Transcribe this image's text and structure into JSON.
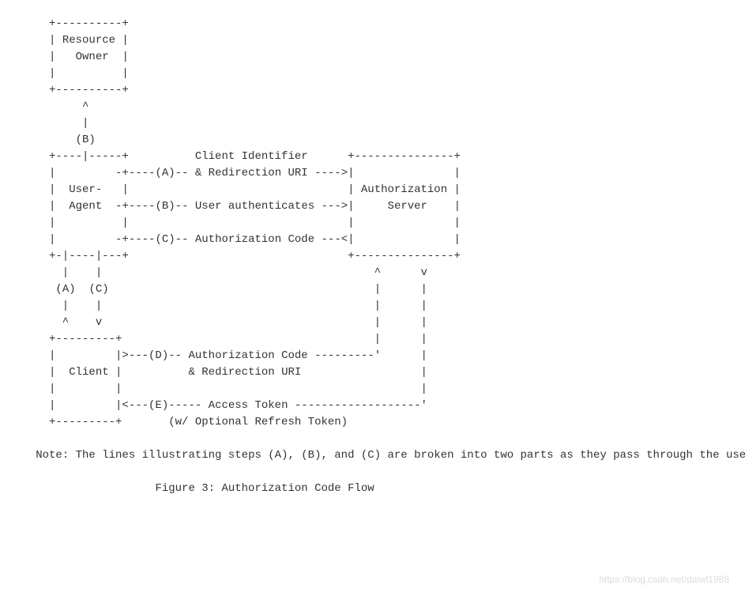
{
  "diagram": {
    "boxes": {
      "resource_owner_line1": "Resource",
      "resource_owner_line2": "Owner",
      "user_agent_line1": "User-",
      "user_agent_line2": "Agent",
      "authorization_server_line1": "Authorization",
      "authorization_server_line2": "Server",
      "client": "Client"
    },
    "steps": {
      "A_label": "(A)",
      "B_label": "(B)",
      "C_label": "(C)",
      "D_label": "(D)",
      "E_label": "(E)"
    },
    "flows": {
      "A_text_line1": "Client Identifier",
      "A_text_line2": "& Redirection URI",
      "B_text": "User authenticates",
      "C_text": "Authorization Code",
      "D_text_line1": "Authorization Code",
      "D_text_line2": "& Redirection URI",
      "E_text_line1": "Access Token",
      "E_text_line2": "(w/ Optional Refresh Token)"
    },
    "note": "Note: The lines illustrating steps (A), (B), and (C) are broken into two parts as they pass through the user-agent.",
    "caption": "Figure 3: Authorization Code Flow"
  },
  "watermark": "https://blog.csdn.net/daiwl1988"
}
